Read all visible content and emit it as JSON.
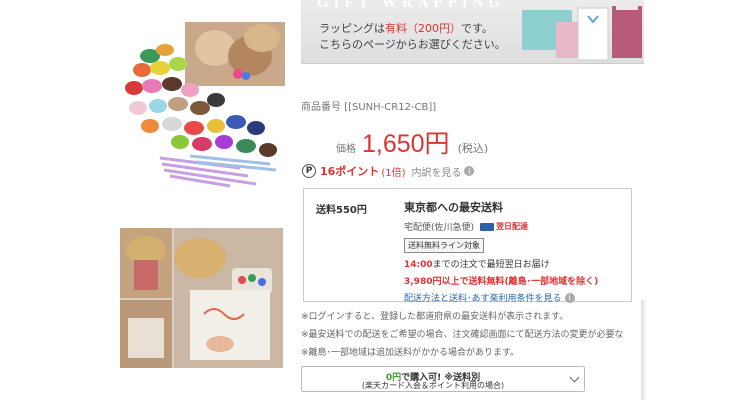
{
  "banner": {
    "title": "GIFT WRAPPING",
    "line1_prefix": "ラッピングは",
    "line1_red": "有料（200円）",
    "line1_suffix": "です。",
    "line2": "こちらのページからお選びください。"
  },
  "product": {
    "item_code": "商品番号 [[SUNH-CR12-CB]]",
    "price_label": "価格",
    "price": "1,650円",
    "tax": "(税込)"
  },
  "points": {
    "icon_letter": "P",
    "value": "16ポイント",
    "multiplier": "(1倍)",
    "detail_link": "内訳を見る",
    "info_glyph": "i"
  },
  "shipping": {
    "fee": "送料550円",
    "title": "東京都への最安送料",
    "carrier": "宅配便(佐川急便)",
    "next_day": "翌日配達",
    "badge": "送料無料ライン対象",
    "deadline_time": "14:00",
    "deadline_text": "までの注文で最短翌日お届け",
    "free_condition": "3,980円以上で送料無料(離島･一部地域を除く)",
    "link": "配送方法と送料･あす楽利用条件を見る"
  },
  "notes": [
    "※ログインすると、登録した都道府県の最安送料が表示されます。",
    "※最安送料での配送をご希望の場合、注文確認画面にて配送方法の変更が必要な",
    "※離島･一部地域は追加送料がかかる場合があります。"
  ],
  "payment_select": {
    "green": "0円",
    "line1_rest": "で購入可! ※送料別",
    "line2": "(楽天カード入会＆ポイント利用の場合)"
  }
}
